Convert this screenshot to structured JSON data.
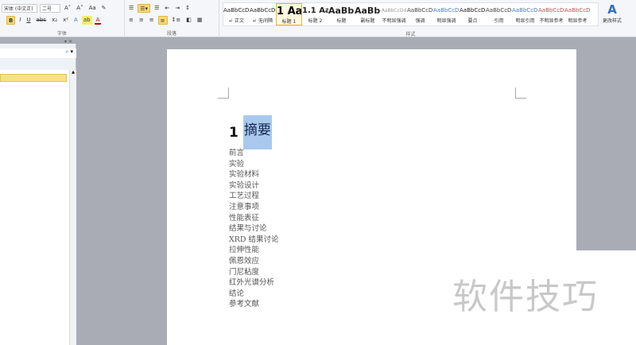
{
  "ribbon": {
    "font_name": "宋体 (中文正)",
    "font_size": "二号",
    "font_group": "字体",
    "para_group": "段落",
    "styles_group": "样式",
    "styles": [
      {
        "preview": "AaBbCcDd",
        "label": "↵ 正文"
      },
      {
        "preview": "AaBbCcDd",
        "label": "↵ 无间隔"
      },
      {
        "preview": "1 Aa",
        "label": "标题 1"
      },
      {
        "preview": "1.1 Aa",
        "label": "标题 2"
      },
      {
        "preview": "AaBbC",
        "label": "标题"
      },
      {
        "preview": "AaBbC",
        "label": "副标题"
      },
      {
        "preview": "AaBbCcDd",
        "label": "不明显强调"
      },
      {
        "preview": "AaBbCcDd",
        "label": "强调"
      },
      {
        "preview": "AaBbCcDd",
        "label": "明显强调"
      },
      {
        "preview": "AaBbCcDd",
        "label": "要点"
      },
      {
        "preview": "AaBbCcDd",
        "label": "引用"
      },
      {
        "preview": "AaBbCcDd",
        "label": "明显引用"
      },
      {
        "preview": "AaBbCcDd",
        "label": "不明显参考"
      },
      {
        "preview": "AaBbCcDd",
        "label": "明显参考"
      }
    ],
    "change_styles": "更改样式"
  },
  "document": {
    "heading_num": "1",
    "heading_text": "摘要",
    "items": [
      "前言",
      "实验",
      "实验材料",
      "实验设计",
      "工艺过程",
      "注意事项",
      "性能表征",
      "结果与讨论",
      "XRD 结果讨论",
      "拉伸性能",
      "佩恩效应",
      "门尼粘度",
      "红外光谱分析",
      "结论",
      "参考文献"
    ]
  },
  "watermark": "软件技巧"
}
